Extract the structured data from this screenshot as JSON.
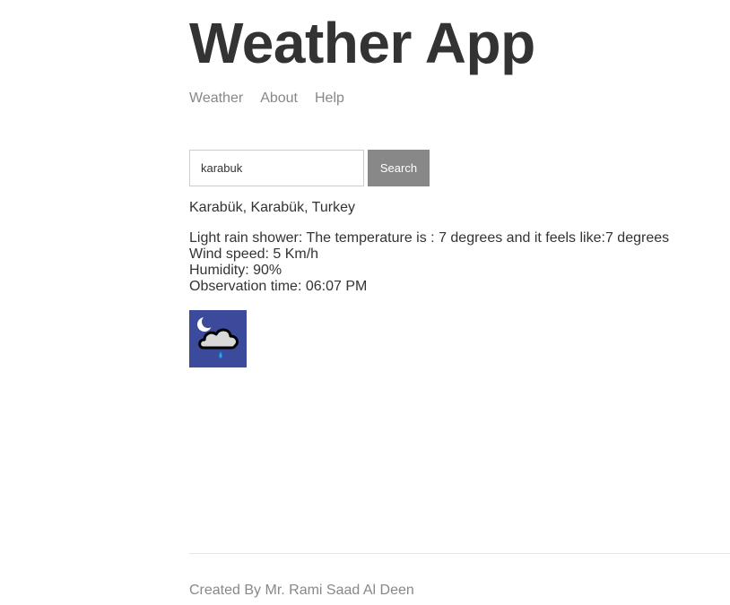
{
  "header": {
    "title": "Weather App"
  },
  "nav": {
    "items": [
      {
        "label": "Weather"
      },
      {
        "label": "About"
      },
      {
        "label": "Help"
      }
    ]
  },
  "search": {
    "value": "karabuk",
    "button_label": "Search"
  },
  "result": {
    "location": "Karabük, Karabük, Turkey",
    "forecast_line": "Light rain shower: The temperature is : 7 degrees and it feels like:7 degrees",
    "wind_line": "Wind speed: 5 Km/h",
    "humidity_line": "Humidity: 90%",
    "observation_line": "Observation time: 06:07 PM",
    "icon": "night-light-rain-shower-icon"
  },
  "footer": {
    "credit": "Created By Mr. Rami Saad Al Deen"
  },
  "colors": {
    "text": "#333333",
    "muted": "#888888",
    "button_bg": "#888888",
    "icon_bg": "#3b4a9a"
  }
}
